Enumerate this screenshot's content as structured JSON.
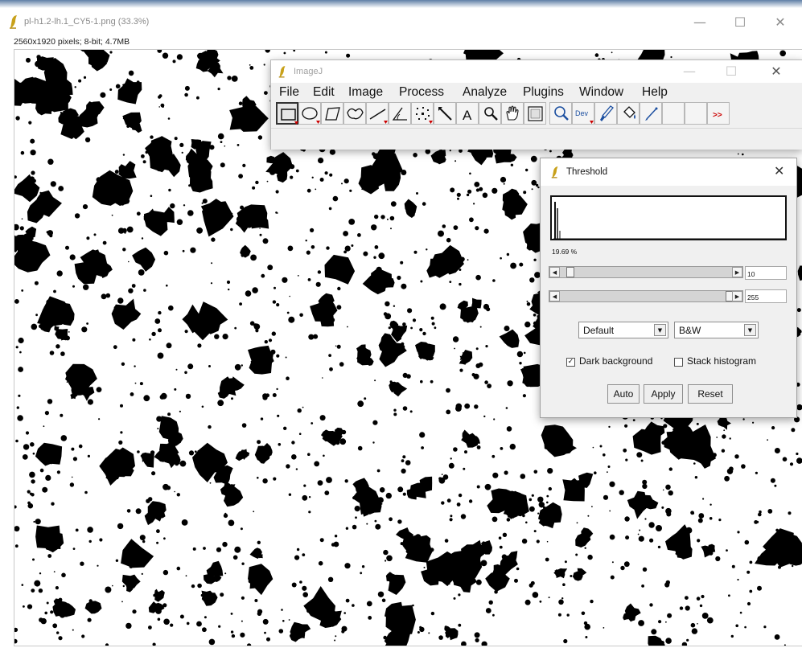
{
  "image_window": {
    "title": "pl-h1.2-lh.1_CY5-1.png (33.3%)",
    "info": "2560x1920 pixels; 8-bit; 4.7MB",
    "controls": {
      "minimize": "—",
      "maximize": "☐",
      "close": "✕"
    }
  },
  "imagej": {
    "title": "ImageJ",
    "controls": {
      "minimize": "—",
      "maximize": "☐",
      "close": "✕"
    },
    "menu": [
      "File",
      "Edit",
      "Image",
      "Process",
      "Analyze",
      "Plugins",
      "Window",
      "Help"
    ],
    "tools": [
      {
        "name": "rectangle-tool-icon",
        "active": true
      },
      {
        "name": "oval-tool-icon"
      },
      {
        "name": "polygon-tool-icon"
      },
      {
        "name": "freehand-tool-icon"
      },
      {
        "name": "line-tool-icon"
      },
      {
        "name": "angle-tool-icon"
      },
      {
        "name": "point-tool-icon"
      },
      {
        "name": "wand-tool-icon"
      },
      {
        "name": "text-tool-icon",
        "label": "A"
      },
      {
        "name": "magnifier-tool-icon"
      },
      {
        "name": "hand-tool-icon"
      },
      {
        "name": "color-picker-tool-icon"
      },
      {
        "name": "zoom-tool-icon"
      },
      {
        "name": "developer-menu-icon",
        "label": "Dev"
      },
      {
        "name": "brush-tool-icon"
      },
      {
        "name": "flood-fill-tool-icon"
      },
      {
        "name": "pencil-tool-icon"
      },
      {
        "name": "empty-tool-slot"
      },
      {
        "name": "empty-tool-slot"
      },
      {
        "name": "more-tools-icon",
        "label": ">>"
      }
    ]
  },
  "threshold": {
    "title": "Threshold",
    "close": "✕",
    "percent": "19.69 %",
    "lower_value": "10",
    "upper_value": "255",
    "lower_fraction": 0.04,
    "upper_fraction": 1.0,
    "method": "Default",
    "mode": "B&W",
    "dark_background_label": "Dark background",
    "dark_background_checked": true,
    "stack_histogram_label": "Stack histogram",
    "stack_histogram_checked": false,
    "buttons": {
      "auto": "Auto",
      "apply": "Apply",
      "reset": "Reset"
    }
  },
  "colors": {
    "imagej_feather": "#c8a11a",
    "toolbar_red_triangle": "#cc0000",
    "toolbar_blue": "#1c4fa0"
  }
}
